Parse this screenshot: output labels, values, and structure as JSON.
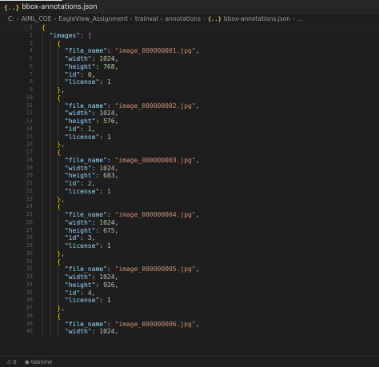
{
  "tab": {
    "icon": "json-braces-icon",
    "icon_glyph": "{..}",
    "label": "bbox-annotations.json"
  },
  "breadcrumb": {
    "items": [
      "C:",
      "AIML_COE",
      "EagleView_Assignment",
      "trainval",
      "annotations"
    ],
    "file_icon_glyph": "{..}",
    "file": "bbox-annotations.json",
    "trail": "..."
  },
  "editor": {
    "lines": [
      {
        "n": "1",
        "t": [
          {
            "c": "tok-bracket",
            "v": "{"
          }
        ]
      },
      {
        "n": "2",
        "t": [
          {
            "c": "tok-punc",
            "v": "  "
          },
          {
            "c": "tok-key",
            "v": "\"images\""
          },
          {
            "c": "tok-punc",
            "v": ": "
          },
          {
            "c": "tok-bracket2",
            "v": "["
          }
        ]
      },
      {
        "n": "3",
        "t": [
          {
            "c": "tok-punc",
            "v": "    "
          },
          {
            "c": "tok-bracket",
            "v": "{"
          }
        ]
      },
      {
        "n": "4",
        "t": [
          {
            "c": "tok-punc",
            "v": "      "
          },
          {
            "c": "tok-key",
            "v": "\"file_name\""
          },
          {
            "c": "tok-punc",
            "v": ": "
          },
          {
            "c": "tok-str",
            "v": "\"image_000000001.jpg\""
          },
          {
            "c": "tok-punc",
            "v": ","
          }
        ]
      },
      {
        "n": "5",
        "t": [
          {
            "c": "tok-punc",
            "v": "      "
          },
          {
            "c": "tok-key",
            "v": "\"width\""
          },
          {
            "c": "tok-punc",
            "v": ": "
          },
          {
            "c": "tok-num",
            "v": "1024"
          },
          {
            "c": "tok-punc",
            "v": ","
          }
        ]
      },
      {
        "n": "6",
        "t": [
          {
            "c": "tok-punc",
            "v": "      "
          },
          {
            "c": "tok-key",
            "v": "\"height\""
          },
          {
            "c": "tok-punc",
            "v": ": "
          },
          {
            "c": "tok-num",
            "v": "768"
          },
          {
            "c": "tok-punc",
            "v": ","
          }
        ]
      },
      {
        "n": "7",
        "t": [
          {
            "c": "tok-punc",
            "v": "      "
          },
          {
            "c": "tok-key",
            "v": "\"id\""
          },
          {
            "c": "tok-punc",
            "v": ": "
          },
          {
            "c": "tok-num",
            "v": "0"
          },
          {
            "c": "tok-punc",
            "v": ","
          }
        ]
      },
      {
        "n": "8",
        "t": [
          {
            "c": "tok-punc",
            "v": "      "
          },
          {
            "c": "tok-key",
            "v": "\"license\""
          },
          {
            "c": "tok-punc",
            "v": ": "
          },
          {
            "c": "tok-num",
            "v": "1"
          }
        ]
      },
      {
        "n": "9",
        "t": [
          {
            "c": "tok-punc",
            "v": "    "
          },
          {
            "c": "tok-bracket",
            "v": "}"
          },
          {
            "c": "tok-punc",
            "v": ","
          }
        ]
      },
      {
        "n": "10",
        "t": [
          {
            "c": "tok-punc",
            "v": "    "
          },
          {
            "c": "tok-bracket",
            "v": "{"
          }
        ]
      },
      {
        "n": "11",
        "t": [
          {
            "c": "tok-punc",
            "v": "      "
          },
          {
            "c": "tok-key",
            "v": "\"file_name\""
          },
          {
            "c": "tok-punc",
            "v": ": "
          },
          {
            "c": "tok-str",
            "v": "\"image_000000002.jpg\""
          },
          {
            "c": "tok-punc",
            "v": ","
          }
        ]
      },
      {
        "n": "12",
        "t": [
          {
            "c": "tok-punc",
            "v": "      "
          },
          {
            "c": "tok-key",
            "v": "\"width\""
          },
          {
            "c": "tok-punc",
            "v": ": "
          },
          {
            "c": "tok-num",
            "v": "1024"
          },
          {
            "c": "tok-punc",
            "v": ","
          }
        ]
      },
      {
        "n": "13",
        "t": [
          {
            "c": "tok-punc",
            "v": "      "
          },
          {
            "c": "tok-key",
            "v": "\"height\""
          },
          {
            "c": "tok-punc",
            "v": ": "
          },
          {
            "c": "tok-num",
            "v": "576"
          },
          {
            "c": "tok-punc",
            "v": ","
          }
        ]
      },
      {
        "n": "14",
        "t": [
          {
            "c": "tok-punc",
            "v": "      "
          },
          {
            "c": "tok-key",
            "v": "\"id\""
          },
          {
            "c": "tok-punc",
            "v": ": "
          },
          {
            "c": "tok-num",
            "v": "1"
          },
          {
            "c": "tok-punc",
            "v": ","
          }
        ]
      },
      {
        "n": "15",
        "t": [
          {
            "c": "tok-punc",
            "v": "      "
          },
          {
            "c": "tok-key",
            "v": "\"license\""
          },
          {
            "c": "tok-punc",
            "v": ": "
          },
          {
            "c": "tok-num",
            "v": "1"
          }
        ]
      },
      {
        "n": "16",
        "t": [
          {
            "c": "tok-punc",
            "v": "    "
          },
          {
            "c": "tok-bracket",
            "v": "}"
          },
          {
            "c": "tok-punc",
            "v": ","
          }
        ]
      },
      {
        "n": "17",
        "t": [
          {
            "c": "tok-punc",
            "v": "    "
          },
          {
            "c": "tok-bracket",
            "v": "{"
          }
        ]
      },
      {
        "n": "18",
        "t": [
          {
            "c": "tok-punc",
            "v": "      "
          },
          {
            "c": "tok-key",
            "v": "\"file_name\""
          },
          {
            "c": "tok-punc",
            "v": ": "
          },
          {
            "c": "tok-str",
            "v": "\"image_000000003.jpg\""
          },
          {
            "c": "tok-punc",
            "v": ","
          }
        ]
      },
      {
        "n": "19",
        "t": [
          {
            "c": "tok-punc",
            "v": "      "
          },
          {
            "c": "tok-key",
            "v": "\"width\""
          },
          {
            "c": "tok-punc",
            "v": ": "
          },
          {
            "c": "tok-num",
            "v": "1024"
          },
          {
            "c": "tok-punc",
            "v": ","
          }
        ]
      },
      {
        "n": "20",
        "t": [
          {
            "c": "tok-punc",
            "v": "      "
          },
          {
            "c": "tok-key",
            "v": "\"height\""
          },
          {
            "c": "tok-punc",
            "v": ": "
          },
          {
            "c": "tok-num",
            "v": "683"
          },
          {
            "c": "tok-punc",
            "v": ","
          }
        ]
      },
      {
        "n": "21",
        "t": [
          {
            "c": "tok-punc",
            "v": "      "
          },
          {
            "c": "tok-key",
            "v": "\"id\""
          },
          {
            "c": "tok-punc",
            "v": ": "
          },
          {
            "c": "tok-num",
            "v": "2"
          },
          {
            "c": "tok-punc",
            "v": ","
          }
        ]
      },
      {
        "n": "22",
        "t": [
          {
            "c": "tok-punc",
            "v": "      "
          },
          {
            "c": "tok-key",
            "v": "\"license\""
          },
          {
            "c": "tok-punc",
            "v": ": "
          },
          {
            "c": "tok-num",
            "v": "1"
          }
        ]
      },
      {
        "n": "23",
        "t": [
          {
            "c": "tok-punc",
            "v": "    "
          },
          {
            "c": "tok-bracket",
            "v": "}"
          },
          {
            "c": "tok-punc",
            "v": ","
          }
        ]
      },
      {
        "n": "24",
        "t": [
          {
            "c": "tok-punc",
            "v": "    "
          },
          {
            "c": "tok-bracket",
            "v": "{"
          }
        ]
      },
      {
        "n": "25",
        "t": [
          {
            "c": "tok-punc",
            "v": "      "
          },
          {
            "c": "tok-key",
            "v": "\"file_name\""
          },
          {
            "c": "tok-punc",
            "v": ": "
          },
          {
            "c": "tok-str",
            "v": "\"image_000000004.jpg\""
          },
          {
            "c": "tok-punc",
            "v": ","
          }
        ]
      },
      {
        "n": "26",
        "t": [
          {
            "c": "tok-punc",
            "v": "      "
          },
          {
            "c": "tok-key",
            "v": "\"width\""
          },
          {
            "c": "tok-punc",
            "v": ": "
          },
          {
            "c": "tok-num",
            "v": "1024"
          },
          {
            "c": "tok-punc",
            "v": ","
          }
        ]
      },
      {
        "n": "27",
        "t": [
          {
            "c": "tok-punc",
            "v": "      "
          },
          {
            "c": "tok-key",
            "v": "\"height\""
          },
          {
            "c": "tok-punc",
            "v": ": "
          },
          {
            "c": "tok-num",
            "v": "675"
          },
          {
            "c": "tok-punc",
            "v": ","
          }
        ]
      },
      {
        "n": "28",
        "t": [
          {
            "c": "tok-punc",
            "v": "      "
          },
          {
            "c": "tok-key",
            "v": "\"id\""
          },
          {
            "c": "tok-punc",
            "v": ": "
          },
          {
            "c": "tok-num",
            "v": "3"
          },
          {
            "c": "tok-punc",
            "v": ","
          }
        ]
      },
      {
        "n": "29",
        "t": [
          {
            "c": "tok-punc",
            "v": "      "
          },
          {
            "c": "tok-key",
            "v": "\"license\""
          },
          {
            "c": "tok-punc",
            "v": ": "
          },
          {
            "c": "tok-num",
            "v": "1"
          }
        ]
      },
      {
        "n": "30",
        "t": [
          {
            "c": "tok-punc",
            "v": "    "
          },
          {
            "c": "tok-bracket",
            "v": "}"
          },
          {
            "c": "tok-punc",
            "v": ","
          }
        ]
      },
      {
        "n": "31",
        "t": [
          {
            "c": "tok-punc",
            "v": "    "
          },
          {
            "c": "tok-bracket",
            "v": "{"
          }
        ]
      },
      {
        "n": "32",
        "t": [
          {
            "c": "tok-punc",
            "v": "      "
          },
          {
            "c": "tok-key",
            "v": "\"file_name\""
          },
          {
            "c": "tok-punc",
            "v": ": "
          },
          {
            "c": "tok-str",
            "v": "\"image_000000005.jpg\""
          },
          {
            "c": "tok-punc",
            "v": ","
          }
        ]
      },
      {
        "n": "33",
        "t": [
          {
            "c": "tok-punc",
            "v": "      "
          },
          {
            "c": "tok-key",
            "v": "\"width\""
          },
          {
            "c": "tok-punc",
            "v": ": "
          },
          {
            "c": "tok-num",
            "v": "1024"
          },
          {
            "c": "tok-punc",
            "v": ","
          }
        ]
      },
      {
        "n": "34",
        "t": [
          {
            "c": "tok-punc",
            "v": "      "
          },
          {
            "c": "tok-key",
            "v": "\"height\""
          },
          {
            "c": "tok-punc",
            "v": ": "
          },
          {
            "c": "tok-num",
            "v": "926"
          },
          {
            "c": "tok-punc",
            "v": ","
          }
        ]
      },
      {
        "n": "35",
        "t": [
          {
            "c": "tok-punc",
            "v": "      "
          },
          {
            "c": "tok-key",
            "v": "\"id\""
          },
          {
            "c": "tok-punc",
            "v": ": "
          },
          {
            "c": "tok-num",
            "v": "4"
          },
          {
            "c": "tok-punc",
            "v": ","
          }
        ]
      },
      {
        "n": "36",
        "t": [
          {
            "c": "tok-punc",
            "v": "      "
          },
          {
            "c": "tok-key",
            "v": "\"license\""
          },
          {
            "c": "tok-punc",
            "v": ": "
          },
          {
            "c": "tok-num",
            "v": "1"
          }
        ]
      },
      {
        "n": "37",
        "t": [
          {
            "c": "tok-punc",
            "v": "    "
          },
          {
            "c": "tok-bracket",
            "v": "}"
          },
          {
            "c": "tok-punc",
            "v": ","
          }
        ]
      },
      {
        "n": "38",
        "t": [
          {
            "c": "tok-punc",
            "v": "    "
          },
          {
            "c": "tok-bracket",
            "v": "{"
          }
        ]
      },
      {
        "n": "39",
        "t": [
          {
            "c": "tok-punc",
            "v": "      "
          },
          {
            "c": "tok-key",
            "v": "\"file_name\""
          },
          {
            "c": "tok-punc",
            "v": ": "
          },
          {
            "c": "tok-str",
            "v": "\"image_000000006.jpg\""
          },
          {
            "c": "tok-punc",
            "v": ","
          }
        ]
      },
      {
        "n": "40",
        "t": [
          {
            "c": "tok-punc",
            "v": "      "
          },
          {
            "c": "tok-key",
            "v": "\"width\""
          },
          {
            "c": "tok-punc",
            "v": ": "
          },
          {
            "c": "tok-num",
            "v": "1024"
          },
          {
            "c": "tok-punc",
            "v": ","
          }
        ]
      }
    ]
  },
  "status": {
    "warning_icon": "warning-icon",
    "warning_glyph": "⚠",
    "warnings": "0",
    "tabnine_icon": "tabnine-icon",
    "tabnine_glyph": "◉",
    "tabnine": "tabnine"
  }
}
